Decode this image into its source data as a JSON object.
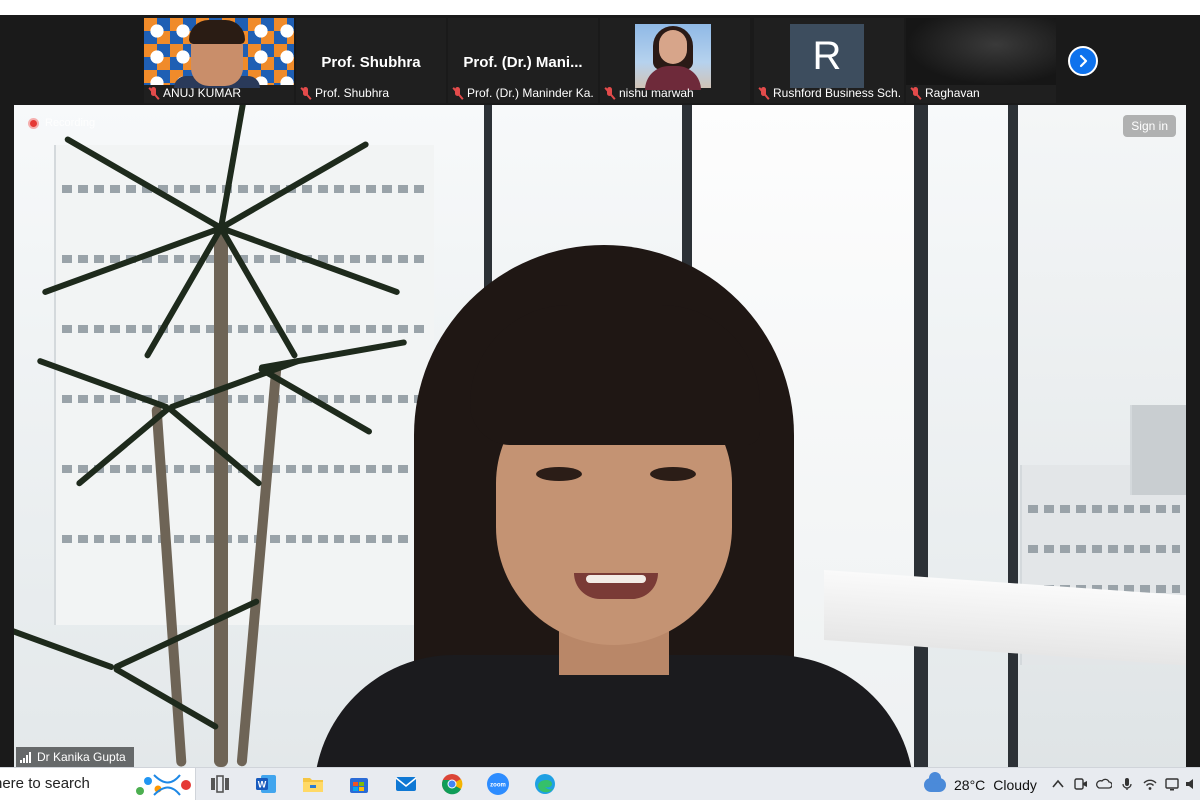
{
  "participants": [
    {
      "name": "ANUJ KUMAR",
      "kind": "video"
    },
    {
      "name": "Prof. Shubhra",
      "label": "Prof. Shubhra",
      "kind": "name"
    },
    {
      "name": "Prof. (Dr.) Maninder Ka...",
      "label": "Prof. (Dr.) Mani...",
      "kind": "name"
    },
    {
      "name": "nishu marwah",
      "kind": "photo"
    },
    {
      "name": "Rushford Business Sch...",
      "initial": "R",
      "kind": "initial"
    },
    {
      "name": "Raghavan",
      "kind": "video"
    }
  ],
  "main_video": {
    "recording_label": "Recording",
    "sign_in_label": "Sign in",
    "speaker_name": "Dr Kanika Gupta"
  },
  "taskbar": {
    "search_text": "here to search",
    "weather_temp": "28°C",
    "weather_condition": "Cloudy",
    "pinned_apps": [
      "task-view",
      "word",
      "file-explorer",
      "microsoft-store",
      "mail",
      "chrome",
      "zoom",
      "edge"
    ]
  },
  "colors": {
    "muted_mic": "#e34b4b",
    "zoom_blue": "#0e72ed",
    "strip_bg": "#1a1a1a"
  }
}
